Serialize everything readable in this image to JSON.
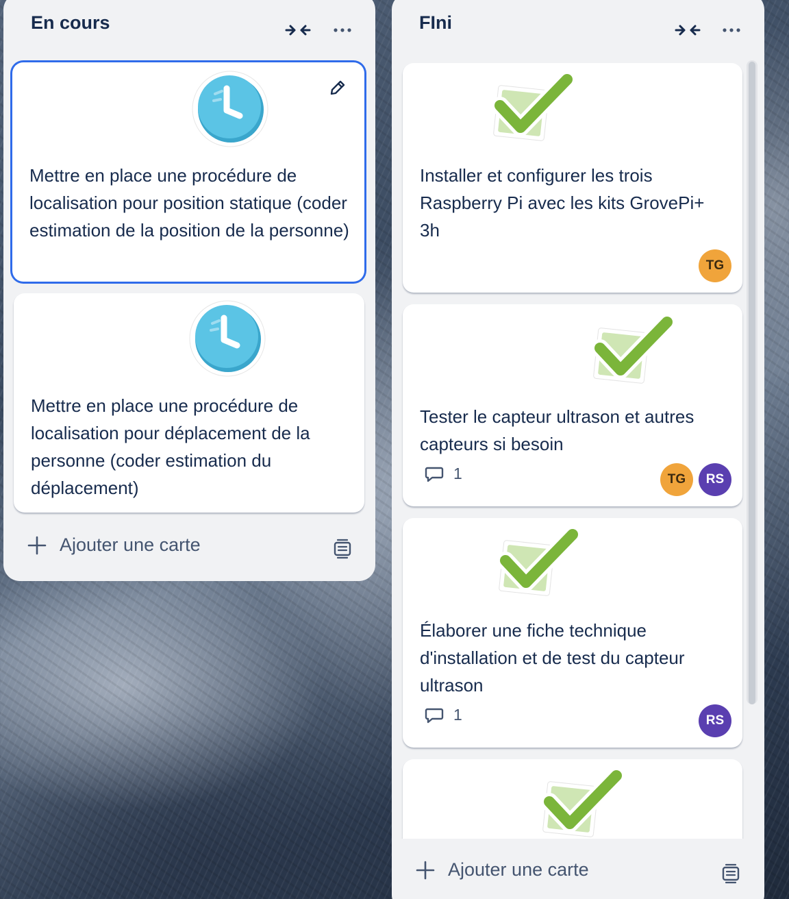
{
  "lists": [
    {
      "title": "En cours",
      "add_card_label": "Ajouter une carte",
      "cards": [
        {
          "text": "Mettre en place une procédure de localisation pour position statique (coder estimation de la position de la personne)",
          "sticker": "clock-icon",
          "selected": true
        },
        {
          "text": "Mettre en place une procédure de localisation pour déplacement de la personne (coder estimation du déplacement)",
          "sticker": "clock-icon"
        }
      ]
    },
    {
      "title": "FIni",
      "add_card_label": "Ajouter une carte",
      "cards": [
        {
          "text": "Installer et configurer les trois Raspberry Pi avec les kits GrovePi+ 3h",
          "sticker": "checkmark-icon",
          "members": [
            "TG"
          ]
        },
        {
          "text": "Tester le capteur ultrason et autres capteurs si besoin",
          "sticker": "checkmark-icon",
          "comments": "1",
          "members": [
            "TG",
            "RS"
          ]
        },
        {
          "text": "Élaborer une fiche technique d'installation et de test du capteur ultrason",
          "sticker": "checkmark-icon",
          "comments": "1",
          "members": [
            "RS"
          ]
        },
        {
          "text": "",
          "sticker": "checkmark-icon"
        }
      ]
    }
  ],
  "colors": {
    "avatar_TG": "#f0a43b",
    "avatar_RS": "#5a3fb0",
    "selected_border": "#2f6bea",
    "clock": "#5bc4e5",
    "check": "#7bb53a"
  }
}
